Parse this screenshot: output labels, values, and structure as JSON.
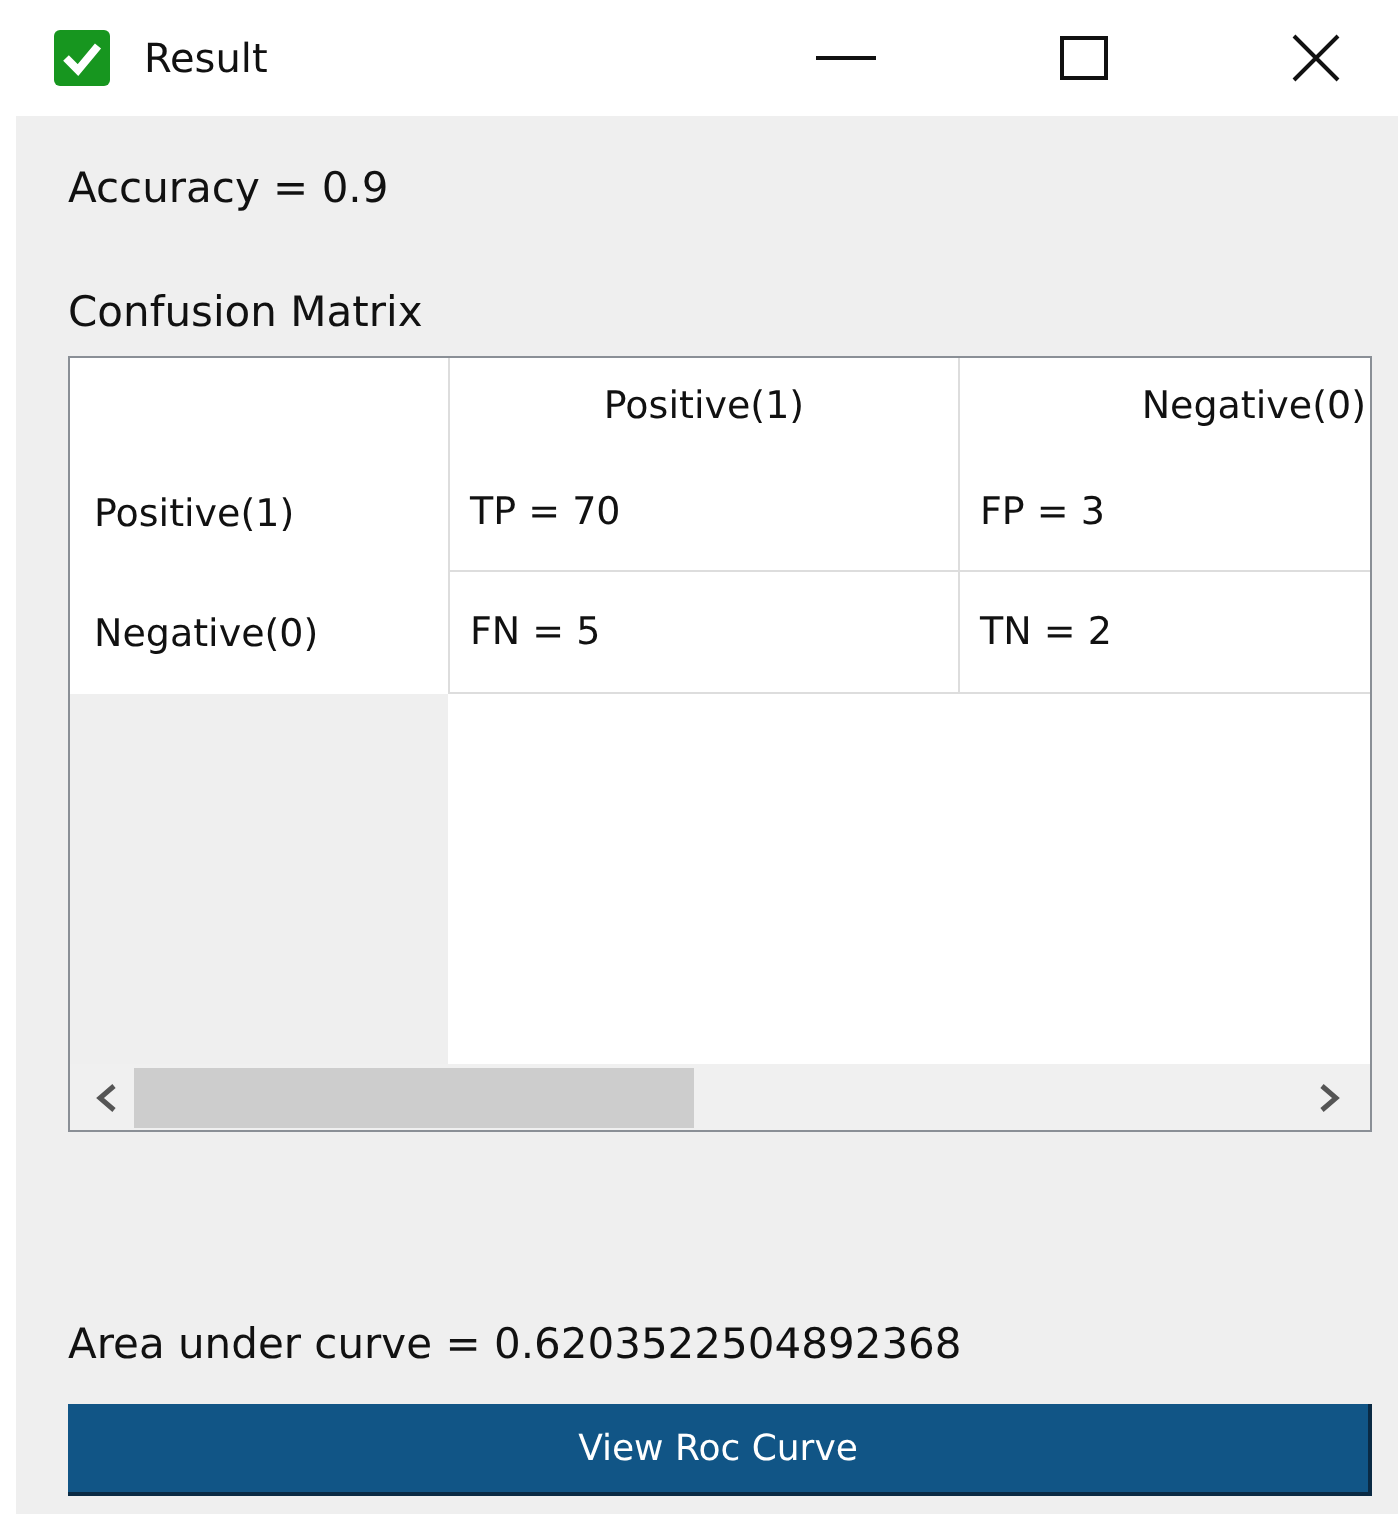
{
  "window": {
    "title": "Result"
  },
  "accuracy": "Accuracy = 0.9",
  "matrix": {
    "title": "Confusion Matrix",
    "columns": [
      "Positive(1)",
      "Negative(0)"
    ],
    "rows": [
      {
        "header": "Positive(1)",
        "cells": [
          "TP = 70",
          "FP = 3"
        ]
      },
      {
        "header": "Negative(0)",
        "cells": [
          "FN = 5",
          "TN = 2"
        ]
      }
    ]
  },
  "auc": "Area under curve = 0.6203522504892368",
  "button": "View Roc Curve"
}
